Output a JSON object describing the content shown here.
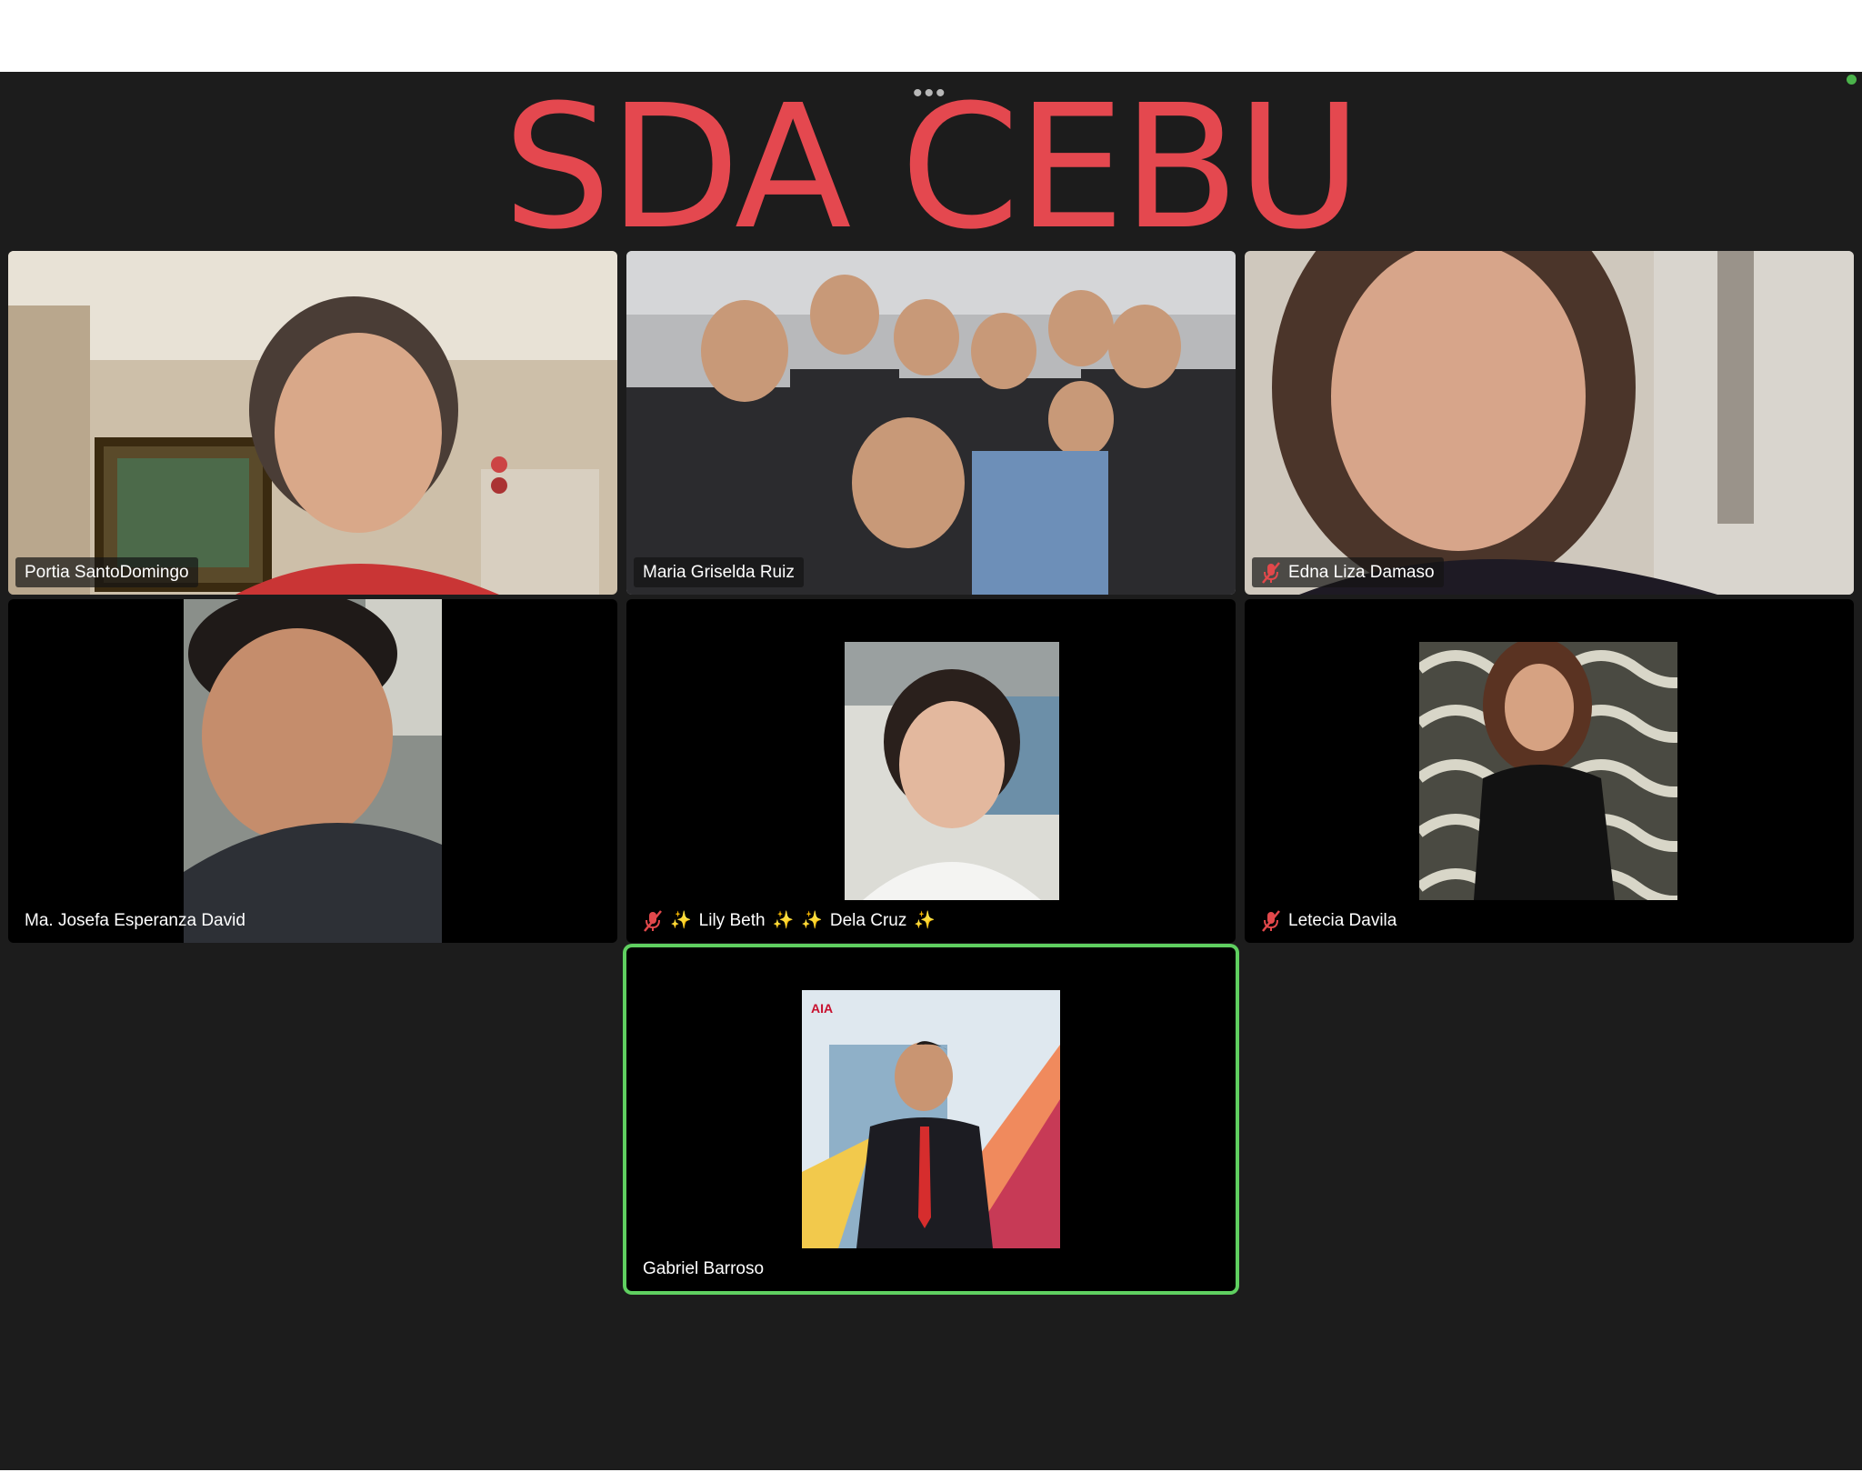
{
  "title": "SDA CEBU",
  "colors": {
    "title": "#e4484f",
    "background": "#1c1c1c",
    "active_border": "#5fcf60",
    "muted_mic": "#e2484b"
  },
  "participants": [
    {
      "name": "Portia SantoDomingo",
      "muted": false,
      "active": false
    },
    {
      "name": "Maria Griselda Ruiz",
      "muted": false,
      "active": false
    },
    {
      "name": "Edna Liza Damaso",
      "muted": true,
      "active": false
    },
    {
      "name": "Ma. Josefa Esperanza David",
      "muted": false,
      "active": false
    },
    {
      "name_part1": "Lily Beth",
      "name_part2": "Dela Cruz",
      "sparkle": "✨",
      "muted": true,
      "active": false
    },
    {
      "name": "Letecia Davila",
      "muted": true,
      "active": false
    },
    {
      "name": "Gabriel Barroso",
      "muted": false,
      "active": true
    }
  ],
  "icons": {
    "more": "more-dots-icon",
    "muted": "microphone-muted-icon"
  }
}
